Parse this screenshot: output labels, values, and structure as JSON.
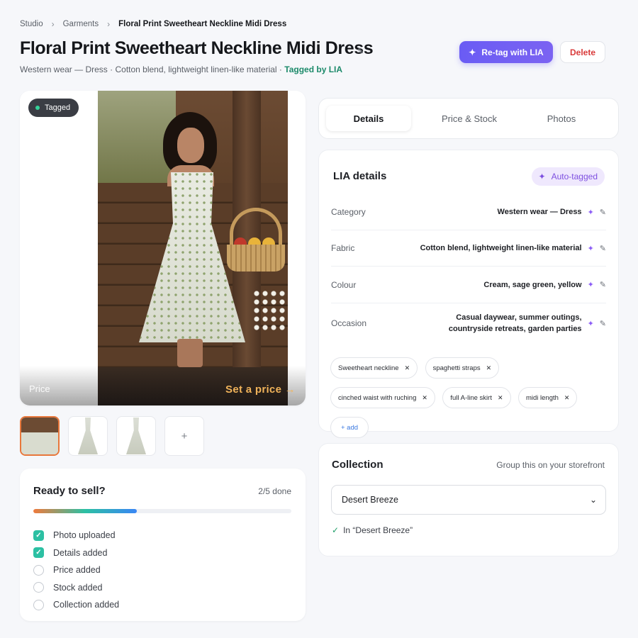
{
  "breadcrumb": [
    "Studio",
    "Garments",
    "Floral Print Sweetheart Neckline Midi Dress"
  ],
  "header": {
    "title": "Floral Print Sweetheart Neckline Midi Dress",
    "subtitle_text": "Western wear — Dress · Cotton blend, lightweight linen-like material · ",
    "subtitle_tagged": "Tagged by LIA",
    "retag_label": "Re-tag with LIA",
    "delete_label": "Delete"
  },
  "photo": {
    "badge": "Tagged",
    "price_label": "Price",
    "set_price": "Set a price →"
  },
  "thumbnails": {
    "count": 3,
    "active_index": 0,
    "add_label": "+"
  },
  "ready": {
    "title": "Ready to sell?",
    "count": "2/5 done",
    "progress": 0.4,
    "items": [
      {
        "label": "Photo uploaded",
        "done": true
      },
      {
        "label": "Details added",
        "done": true
      },
      {
        "label": "Price added",
        "done": false
      },
      {
        "label": "Stock added",
        "done": false
      },
      {
        "label": "Collection added",
        "done": false
      }
    ]
  },
  "tabs": [
    {
      "label": "Details",
      "active": true
    },
    {
      "label": "Price & Stock",
      "active": false
    },
    {
      "label": "Photos",
      "active": false
    }
  ],
  "lia": {
    "title": "LIA details",
    "auto_tag_label": "Auto-tagged",
    "attributes": [
      {
        "label": "Category",
        "value": "Western wear — Dress"
      },
      {
        "label": "Fabric",
        "value": "Cotton blend, lightweight linen-like material"
      },
      {
        "label": "Colour",
        "value": "Cream, sage green, yellow"
      },
      {
        "label": "Occasion",
        "value": "Casual daywear, summer outings, countryside retreats, garden parties"
      }
    ],
    "tags": [
      "Sweetheart neckline",
      "spaghetti straps",
      "cinched waist with ruching",
      "full A-line skirt",
      "midi length"
    ],
    "add_tag_label": "+ add"
  },
  "collection": {
    "title": "Collection",
    "hint": "Group this on your storefront",
    "selected": "Desert Breeze",
    "confirmation": "In “Desert Breeze”"
  },
  "icons": {
    "sparkle": "sparkle-icon",
    "pencil": "pencil-icon",
    "chevron": "chevron-down-icon",
    "remove": "close-icon"
  },
  "colors": {
    "accent": "#6a5cf4",
    "danger": "#d93a3a",
    "success": "#2cc0a3",
    "price_cta": "#f0b35a"
  }
}
